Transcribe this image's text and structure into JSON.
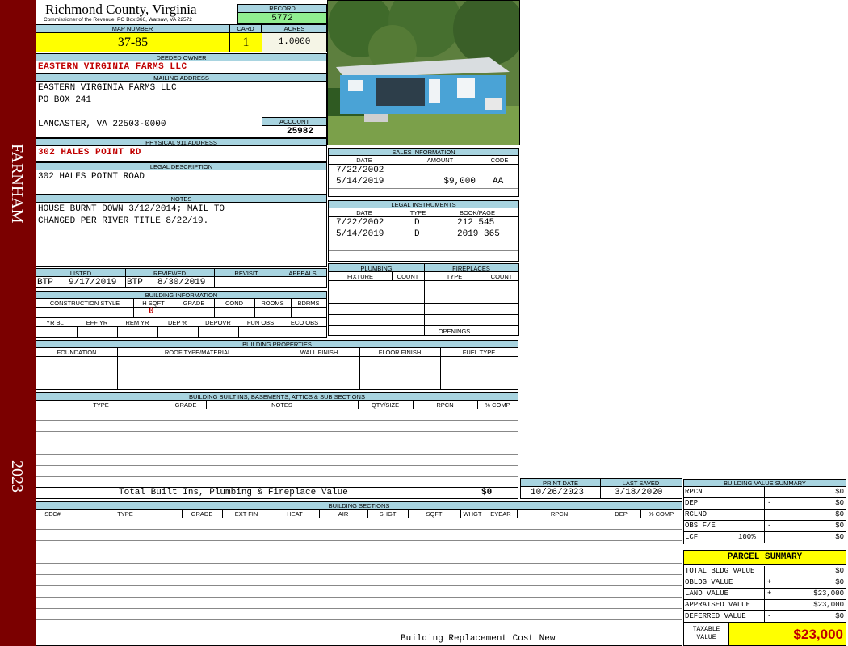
{
  "county": {
    "name": "Richmond County, Virginia",
    "commissioner": "Commissioner of the Revenue, PO Box 366, Warsaw, VA 22572"
  },
  "sidebar": {
    "district": "FARNHAM",
    "year": "2023"
  },
  "record": {
    "label": "RECORD",
    "value": "5772"
  },
  "map": {
    "label": "MAP NUMBER",
    "value": "37-85"
  },
  "card": {
    "label": "CARD",
    "value": "1"
  },
  "acres": {
    "label": "ACRES",
    "value": "1.0000"
  },
  "owner": {
    "label": "DEEDED OWNER",
    "value": "EASTERN VIRGINIA FARMS LLC"
  },
  "mailing": {
    "label": "MAILING ADDRESS",
    "line1": "EASTERN VIRGINIA FARMS LLC",
    "line2": "PO BOX 241",
    "line3": "LANCASTER, VA 22503-0000"
  },
  "account": {
    "label": "ACCOUNT",
    "value": "25982"
  },
  "physical": {
    "label": "PHYSICAL 911 ADDRESS",
    "value": "302 HALES POINT RD"
  },
  "legal": {
    "label": "LEGAL DESCRIPTION",
    "value": "302 HALES POINT ROAD"
  },
  "notes": {
    "label": "NOTES",
    "line1": "HOUSE BURNT DOWN 3/12/2014; MAIL TO",
    "line2": "CHANGED PER RIVER TITLE 8/22/19."
  },
  "sales": {
    "title": "SALES INFORMATION",
    "headers": [
      "DATE",
      "AMOUNT",
      "CODE"
    ],
    "rows": [
      {
        "date": "7/22/2002",
        "amount": "",
        "code": ""
      },
      {
        "date": "5/14/2019",
        "amount": "$9,000",
        "code": "AA"
      }
    ]
  },
  "instruments": {
    "title": "LEGAL INSTRUMENTS",
    "headers": [
      "DATE",
      "TYPE",
      "BOOK/PAGE"
    ],
    "rows": [
      {
        "date": "7/22/2002",
        "type": "D",
        "book": "212 545"
      },
      {
        "date": "5/14/2019",
        "type": "D",
        "book": "2019 365"
      }
    ]
  },
  "review": {
    "headers": [
      "LISTED",
      "REVIEWED",
      "REVISIT",
      "APPEALS"
    ],
    "listed_by": "BTP",
    "listed_date": "9/17/2019",
    "reviewed_by": "BTP",
    "reviewed_date": "8/30/2019"
  },
  "plumbing": {
    "title": "PLUMBING",
    "headers": [
      "FIXTURE",
      "COUNT"
    ]
  },
  "fireplaces": {
    "title": "FIREPLACES",
    "headers": [
      "TYPE",
      "COUNT"
    ],
    "openings": "OPENINGS"
  },
  "building_info": {
    "title": "BUILDING INFORMATION",
    "headers1": [
      "CONSTRUCTION STYLE",
      "H SQFT",
      "GRADE",
      "COND",
      "ROOMS",
      "BDRMS"
    ],
    "hsqft": "0",
    "headers2": [
      "YR BLT",
      "EFF YR",
      "REM YR",
      "DEP %",
      "DEPOVR",
      "FUN OBS",
      "ECO OBS"
    ]
  },
  "properties": {
    "title": "BUILDING PROPERTIES",
    "headers": [
      "FOUNDATION",
      "ROOF TYPE/MATERIAL",
      "WALL FINISH",
      "FLOOR FINISH",
      "FUEL TYPE"
    ]
  },
  "builtins": {
    "title": "BUILDING BUILT INS, BASEMENTS, ATTICS & SUB SECTIONS",
    "headers": [
      "TYPE",
      "GRADE",
      "NOTES",
      "QTY/SIZE",
      "RPCN",
      "% COMP"
    ],
    "total_label": "Total Built Ins, Plumbing & Fireplace Value",
    "total_value": "$0"
  },
  "print": {
    "print_label": "PRINT DATE",
    "print_value": "10/26/2023",
    "saved_label": "LAST SAVED",
    "saved_value": "3/18/2020"
  },
  "sections": {
    "title": "BUILDING SECTIONS",
    "headers": [
      "SEC#",
      "TYPE",
      "GRADE",
      "EXT FIN",
      "HEAT",
      "AIR",
      "SHGT",
      "SQFT",
      "WHGT",
      "EYEAR",
      "RPCN",
      "DEP",
      "% COMP"
    ],
    "footer": "Building Replacement Cost New"
  },
  "bvs": {
    "title": "BUILDING VALUE SUMMARY",
    "rows": [
      {
        "k": "RPCN",
        "s": "",
        "v": "$0"
      },
      {
        "k": "DEP",
        "s": "-",
        "v": "$0"
      },
      {
        "k": "RCLND",
        "s": "",
        "v": "$0"
      },
      {
        "k": "OBS F/E",
        "s": "-",
        "v": "$0"
      },
      {
        "k": "LCF",
        "pct": "100%",
        "s": "",
        "v": "$0"
      }
    ]
  },
  "parcel": {
    "title": "PARCEL SUMMARY",
    "rows": [
      {
        "k": "TOTAL BLDG VALUE",
        "s": "",
        "v": "$0"
      },
      {
        "k": "OBLDG VALUE",
        "s": "+",
        "v": "$0"
      },
      {
        "k": "LAND VALUE",
        "s": "+",
        "v": "$23,000"
      },
      {
        "k": "APPRAISED VALUE",
        "s": "",
        "v": "$23,000"
      },
      {
        "k": "DEFERRED VALUE",
        "s": "-",
        "v": "$0"
      }
    ],
    "taxable_label1": "TAXABLE",
    "taxable_label2": "VALUE",
    "taxable_value": "$23,000"
  },
  "colors": {
    "sidebar": "#7b0000",
    "header": "#a8d4e0",
    "highlight": "#ffff00",
    "red": "#c00000",
    "record": "#90ee90"
  }
}
